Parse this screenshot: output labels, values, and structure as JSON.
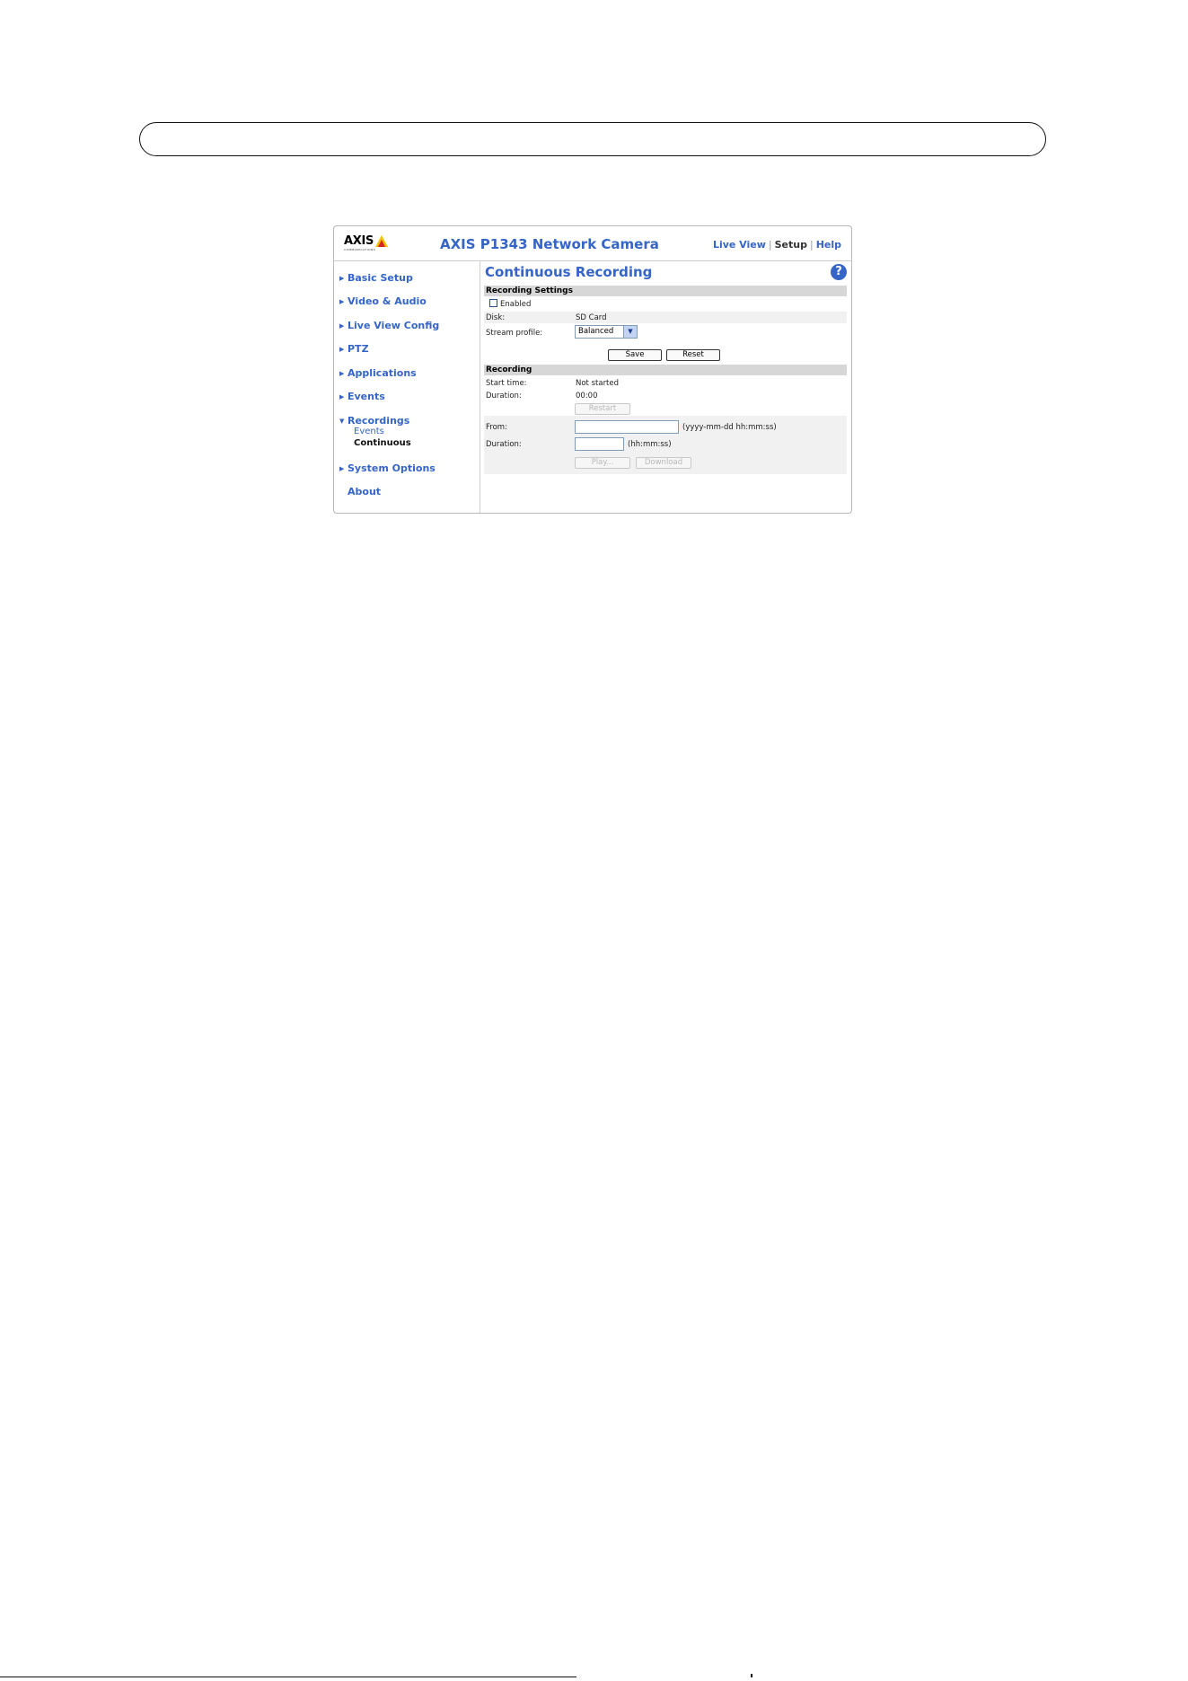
{
  "app": {
    "logo_text": "AXIS",
    "logo_subtext": "COMMUNICATIONS",
    "title": "AXIS P1343 Network Camera",
    "links": [
      {
        "label": "Live View",
        "current": false
      },
      {
        "label": "Setup",
        "current": true
      },
      {
        "label": "Help",
        "current": false
      }
    ],
    "link_separator": "|"
  },
  "sidebar": {
    "items": [
      {
        "label": "Basic Setup",
        "expanded": false
      },
      {
        "label": "Video & Audio",
        "expanded": false
      },
      {
        "label": "Live View Config",
        "expanded": false
      },
      {
        "label": "PTZ",
        "expanded": false
      },
      {
        "label": "Applications",
        "expanded": false
      },
      {
        "label": "Events",
        "expanded": false
      },
      {
        "label": "Recordings",
        "expanded": true
      },
      {
        "label": "System Options",
        "expanded": false
      },
      {
        "label": "About",
        "expanded": false
      }
    ],
    "recordings_subitems": [
      {
        "label": "Events",
        "selected": false
      },
      {
        "label": "Continuous",
        "selected": true
      }
    ]
  },
  "main": {
    "title": "Continuous Recording",
    "help_glyph": "?",
    "recording_settings": {
      "header": "Recording Settings",
      "enabled_label": "Enabled",
      "enabled_checked": false,
      "disk_label": "Disk:",
      "disk_value": "SD Card",
      "stream_profile_label": "Stream profile:",
      "stream_profile_value": "Balanced",
      "save_label": "Save",
      "reset_label": "Reset"
    },
    "recording": {
      "header": "Recording",
      "start_time_label": "Start time:",
      "start_time_value": "Not started",
      "duration_label": "Duration:",
      "duration_value": "00:00",
      "restart_label": "Restart",
      "from_label": "From:",
      "from_value": "",
      "from_hint": "(yyyy-mm-dd hh:mm:ss)",
      "duration2_label": "Duration:",
      "duration2_value": "",
      "duration2_hint": "(hh:mm:ss)",
      "play_label": "Play...",
      "download_label": "Download"
    }
  },
  "colors": {
    "accent": "#3465c7",
    "section_header": "#d7d7d7",
    "row_shade": "#f1f1f1"
  }
}
